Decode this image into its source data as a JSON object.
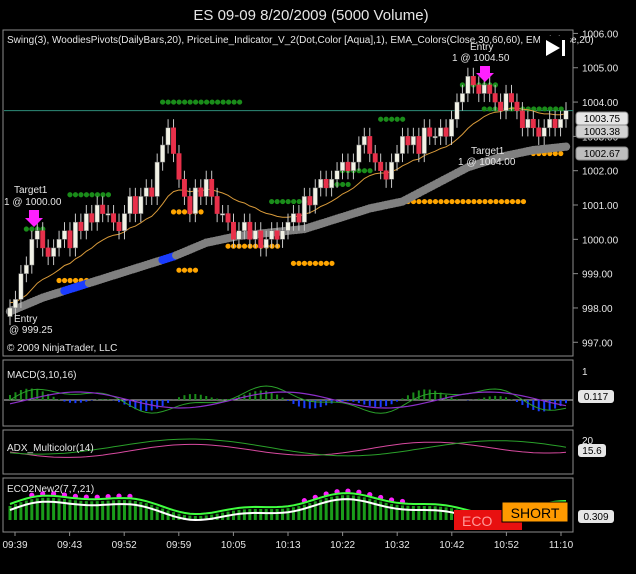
{
  "window": {
    "title": "ES 09-09  8/20/2009 (5000 Volume)"
  },
  "colors": {
    "background": "#000000",
    "text": "#e6e6e6",
    "candle_up": "#f2f2e6",
    "candle_down": "#e8304a",
    "candle_wick": "#c8c8c8",
    "ema_band": "#808080",
    "ema_trend_blue": "#1a3cff",
    "ema_line": "#d89a3a",
    "pivot_green": "#1a8c1a",
    "pivot_orange": "#ffa500",
    "entry_arrow": "#ff20ff",
    "target_arrow": "#1a4cff",
    "priceline": "#2e8b7a",
    "macd_line": "#8a8a8a",
    "macd_signal": "#8c2fc8",
    "macd_hist": "#1a3cff",
    "macd_hist_green": "#1a8c1a",
    "adx_green": "#2aa02a",
    "adx_pink": "#d84aa0",
    "eco_green": "#1a9c1a",
    "eco_white": "#ffffff",
    "eco_magenta": "#ff20ff",
    "eco_yellow": "#ffff00",
    "eco_lime": "#40ff40",
    "eco_red": "#e81010",
    "short_orange": "#ff9a00",
    "panel_divider": "#8c8c8c"
  },
  "price_panel": {
    "indicator_label": "Swing(3), WoodiesPivots(DailyBars,20), PriceLine_Indicator_V_2(Dot,Color [Aqua],1), EMA_Colors(Close,30,60,60), EMA(Close,20)",
    "copyright": "© 2009 NinjaTrader, LLC",
    "markers": {
      "entry_long_label": "Entry",
      "entry_long_price": "@ 999.25",
      "target_long_label": "Target1",
      "target_long_price": "1 @ 1000.00",
      "entry_short_label": "Entry",
      "entry_short_price": "1 @ 1004.50",
      "target_short_label": "Target1",
      "target_short_price": "1 @ 1004.00"
    },
    "price_badges": [
      "1003.75",
      "1003.38",
      "1002.67"
    ]
  },
  "macd_panel": {
    "label": "MACD(3,10,16)",
    "badge": "0.117",
    "tick_top": "1"
  },
  "adx_panel": {
    "label": "ADX_Multicolor(14)",
    "badge": "15.6",
    "tick_top": "20"
  },
  "eco_panel": {
    "label": "ECO2New2(7,7,21)",
    "badge": "0.309",
    "eco_label": "ECO",
    "short_label": "SHORT"
  },
  "chart_data": {
    "type": "candlestick",
    "title": "ES 09-09  8/20/2009 (5000 Volume)",
    "y_ticks": [
      "1006.00",
      "1005.00",
      "1004.00",
      "1003.00",
      "1002.00",
      "1001.00",
      "1000.00",
      "999.00",
      "998.00",
      "997.00"
    ],
    "y_range": [
      996.6,
      1006.1
    ],
    "x_ticks": [
      "09:39",
      "09:43",
      "09:52",
      "09:59",
      "10:05",
      "10:13",
      "10:22",
      "10:32",
      "10:42",
      "10:52",
      "11:10"
    ],
    "close": [
      998.0,
      998.25,
      999.0,
      999.25,
      1000.0,
      1000.25,
      999.75,
      999.5,
      999.75,
      1000.0,
      1000.25,
      999.75,
      1000.5,
      1000.25,
      1000.75,
      1000.5,
      1001.0,
      1000.75,
      1000.75,
      1000.5,
      1000.25,
      1000.75,
      1001.25,
      1000.75,
      1001.25,
      1001.5,
      1001.25,
      1002.25,
      1002.75,
      1003.25,
      1002.5,
      1001.75,
      1001.25,
      1000.75,
      1001.5,
      1001.25,
      1001.75,
      1001.25,
      1000.75,
      1000.75,
      1000.5,
      1000.0,
      1000.25,
      1000.5,
      1000.0,
      1000.25,
      999.75,
      1000.0,
      1000.25,
      1000.0,
      1000.25,
      1000.5,
      1000.75,
      1000.5,
      1001.25,
      1001.0,
      1001.5,
      1001.75,
      1001.5,
      1001.75,
      1002.0,
      1002.25,
      1002.0,
      1002.25,
      1002.75,
      1003.0,
      1002.5,
      1002.25,
      1002.0,
      1001.75,
      1002.25,
      1002.5,
      1003.0,
      1002.75,
      1003.0,
      1002.5,
      1003.25,
      1003.0,
      1003.0,
      1003.25,
      1003.0,
      1003.5,
      1004.0,
      1004.25,
      1004.75,
      1004.5,
      1004.25,
      1004.5,
      1004.25,
      1004.0,
      1003.75,
      1004.25,
      1004.0,
      1003.75,
      1003.25,
      1003.5,
      1003.25,
      1003.0,
      1003.25,
      1003.5,
      1003.25,
      1003.5,
      1003.75
    ],
    "ema_band_points": [
      [
        0,
        997.9
      ],
      [
        6,
        998.3
      ],
      [
        12,
        998.6
      ],
      [
        18,
        998.9
      ],
      [
        24,
        999.2
      ],
      [
        30,
        999.5
      ],
      [
        36,
        999.9
      ],
      [
        42,
        1000.1
      ],
      [
        48,
        1000.2
      ],
      [
        54,
        1000.3
      ],
      [
        60,
        1000.6
      ],
      [
        66,
        1000.9
      ],
      [
        72,
        1001.1
      ],
      [
        78,
        1001.6
      ],
      [
        84,
        1002.1
      ],
      [
        90,
        1002.4
      ],
      [
        96,
        1002.6
      ],
      [
        102,
        1002.7
      ]
    ],
    "ema_blue_segments": [
      [
        10,
        14
      ],
      [
        28,
        30
      ]
    ],
    "pivot_green_levels": [
      {
        "x": [
          3,
          7
        ],
        "y": 1000.3
      },
      {
        "x": [
          11,
          19
        ],
        "y": 1001.3
      },
      {
        "x": [
          28,
          43
        ],
        "y": 1004.0
      },
      {
        "x": [
          48,
          55
        ],
        "y": 1001.1
      },
      {
        "x": [
          58,
          63
        ],
        "y": 1001.6
      },
      {
        "x": [
          61,
          67
        ],
        "y": 1002.0
      },
      {
        "x": [
          68,
          73
        ],
        "y": 1003.5
      },
      {
        "x": [
          83,
          90
        ],
        "y": 1004.5
      },
      {
        "x": [
          87,
          102
        ],
        "y": 1003.8
      }
    ],
    "pivot_orange_levels": [
      {
        "x": [
          9,
          15
        ],
        "y": 998.8
      },
      {
        "x": [
          30,
          36
        ],
        "y": 1000.8
      },
      {
        "x": [
          31,
          35
        ],
        "y": 999.1
      },
      {
        "x": [
          40,
          50
        ],
        "y": 999.8
      },
      {
        "x": [
          52,
          60
        ],
        "y": 999.3
      },
      {
        "x": [
          72,
          95
        ],
        "y": 1001.1
      },
      {
        "x": [
          96,
          102
        ],
        "y": 1002.5
      }
    ],
    "price_line": 1003.75,
    "legend": [
      "Swing(3)",
      "WoodiesPivots(DailyBars,20)",
      "PriceLine_Indicator_V_2(Dot,Color [Aqua],1)",
      "EMA_Colors(Close,30,60,60)",
      "EMA(Close,20)"
    ]
  }
}
